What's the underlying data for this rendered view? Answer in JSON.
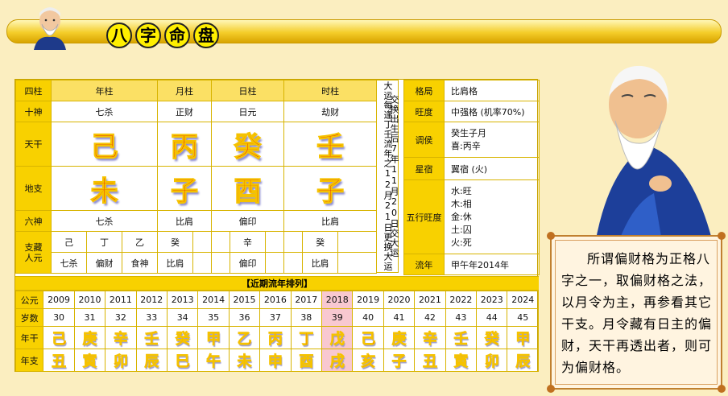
{
  "title_chars": [
    "八",
    "字",
    "命",
    "盘"
  ],
  "pillars": {
    "label_col": "四柱",
    "headers": [
      "年柱",
      "月柱",
      "日柱",
      "时柱"
    ],
    "shishen_label": "十神",
    "shishen": [
      "七杀",
      "正财",
      "日元",
      "劫财"
    ],
    "tiangan_label": "天干",
    "tiangan": [
      "己",
      "丙",
      "癸",
      "壬"
    ],
    "dizhi_label": "地支",
    "dizhi": [
      "未",
      "子",
      "酉",
      "子"
    ],
    "liushen_label": "六神",
    "liushen": [
      "七杀",
      "比肩",
      "偏印",
      "比肩"
    ],
    "canggan_label": "支藏人元",
    "canggan": [
      [
        "己",
        "丁",
        "乙"
      ],
      [
        "癸",
        "",
        ""
      ],
      [
        "辛",
        "",
        ""
      ],
      [
        "癸",
        "",
        ""
      ]
    ],
    "canggan_shen": [
      [
        "七杀",
        "偏财",
        "食神"
      ],
      [
        "比肩",
        "",
        ""
      ],
      [
        "偏印",
        "",
        ""
      ],
      [
        "比肩",
        "",
        ""
      ]
    ]
  },
  "dayun_vertical": {
    "col1": "大运",
    "col2": "交换",
    "text": "每逢丁壬流年之12月21日更换大运",
    "text2": "出生后7年11月20日交大运"
  },
  "side_info": [
    {
      "label": "格局",
      "value": "比肩格"
    },
    {
      "label": "旺度",
      "value": "中强格 (机率70%)"
    },
    {
      "label": "调侯",
      "value": "癸生子月\n喜:丙辛"
    },
    {
      "label": "星宿",
      "value": "翼宿 (火)"
    },
    {
      "label": "五行旺度",
      "value": "水:旺\n木:相\n金:休\n土:囚\n火:死"
    },
    {
      "label": "流年",
      "value": "甲午年2014年"
    }
  ],
  "liunian": {
    "title": "【近期流年排列】",
    "year_label": "公元",
    "age_label": "岁数",
    "gan_label": "年干",
    "zhi_label": "年支",
    "years": [
      "2009",
      "2010",
      "2011",
      "2012",
      "2013",
      "2014",
      "2015",
      "2016",
      "2017",
      "2018",
      "2019",
      "2020",
      "2021",
      "2022",
      "2023",
      "2024"
    ],
    "ages": [
      "30",
      "31",
      "32",
      "33",
      "34",
      "35",
      "36",
      "37",
      "38",
      "39",
      "40",
      "41",
      "42",
      "43",
      "44",
      "45"
    ],
    "gan": [
      "己",
      "庚",
      "辛",
      "壬",
      "癸",
      "甲",
      "乙",
      "丙",
      "丁",
      "戊",
      "己",
      "庚",
      "辛",
      "壬",
      "癸",
      "甲"
    ],
    "zhi": [
      "丑",
      "寅",
      "卯",
      "辰",
      "巳",
      "午",
      "未",
      "申",
      "酉",
      "戌",
      "亥",
      "子",
      "丑",
      "寅",
      "卯",
      "辰"
    ],
    "highlight_index": 9
  },
  "explanation": "所谓偏财格为正格八字之一，取偏财格之法，以月令为主，再参看其它干支。月令藏有日主的偏财，天干再透出者，则可为偏财格。",
  "colors": {
    "accent": "#f8d100",
    "glyph_red": "#e40000",
    "highlight": "#f8c8d0"
  }
}
